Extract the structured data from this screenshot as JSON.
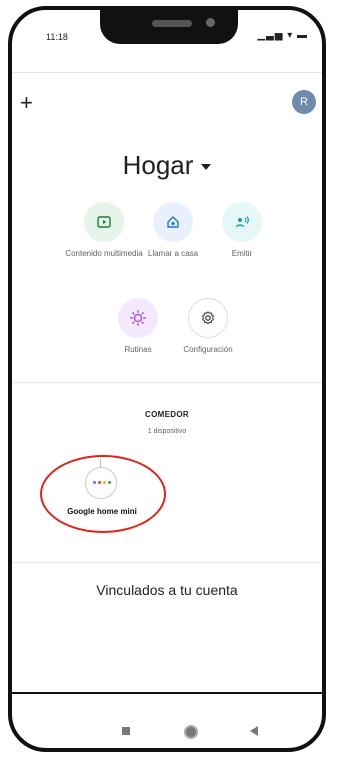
{
  "status_bar": {
    "time": "11:18",
    "icons": "▁▃▅ ▾ ▬"
  },
  "header": {
    "add_glyph": "+",
    "avatar_initial": "R"
  },
  "home": {
    "title": "Hogar"
  },
  "actions": [
    {
      "label": "Contenido multimedia",
      "icon": "media-icon",
      "bg": "#e6f4ea",
      "fg": "#188038"
    },
    {
      "label": "Llamar a casa",
      "icon": "call-home-icon",
      "bg": "#e8f0fe",
      "fg": "#1a73e8"
    },
    {
      "label": "Emitir",
      "icon": "broadcast-icon",
      "bg": "#e6f7f7",
      "fg": "#129eaf"
    },
    {
      "label": "Rutinas",
      "icon": "routines-icon",
      "bg": "#f3e8fd",
      "fg": "#a142f4"
    },
    {
      "label": "Configuración",
      "icon": "settings-icon",
      "bg": "#ffffff",
      "fg": "#3c4043"
    }
  ],
  "room": {
    "name": "COMEDOR",
    "device_count": "1 dispositivo"
  },
  "device": {
    "name": "Google home mini",
    "dot_colors": [
      "#4285f4",
      "#ea4335",
      "#fbbc05",
      "#34a853"
    ],
    "highlight_color": "#e0241c"
  },
  "linked_section": {
    "title": "Vinculados a tu cuenta"
  }
}
